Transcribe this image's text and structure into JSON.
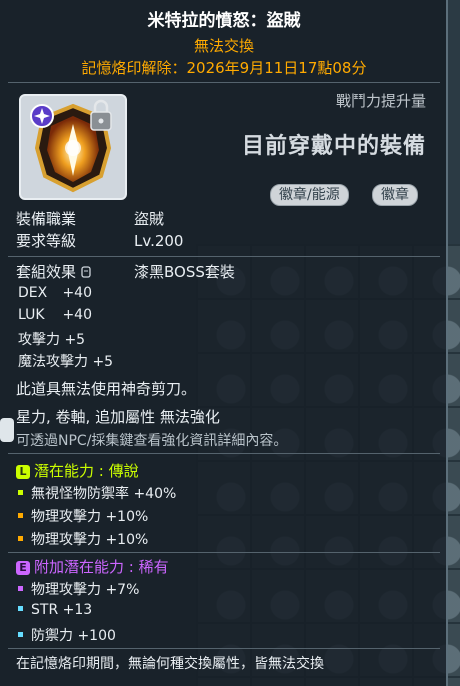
{
  "item": {
    "title": "米特拉的憤怒：盜賊",
    "trade_status": "無法交換",
    "unseal_info": "記憶烙印解除：2026年9月11日17點08分",
    "icon": "mitra-emblem-icon",
    "lock_icon": "lock-icon"
  },
  "header": {
    "power_label": "戰鬥力提升量",
    "wearing_label": "目前穿戴中的裝備",
    "tags": [
      "徽章/能源",
      "徽章"
    ]
  },
  "requirements": {
    "job_label": "裝備職業",
    "job_value": "盜賊",
    "level_label": "要求等級",
    "level_value": "Lv.200"
  },
  "set": {
    "label": "套組效果",
    "value": "漆黑BOSS套裝"
  },
  "stats": [
    {
      "name": "DEX",
      "value": "+40"
    },
    {
      "name": "LUK",
      "value": "+40"
    },
    {
      "name": "攻擊力",
      "value": "+5"
    },
    {
      "name": "魔法攻擊力",
      "value": "+5"
    }
  ],
  "notes": {
    "scissors": "此道具無法使用神奇剪刀。",
    "enhance": "星力, 卷軸, 追加屬性 無法強化",
    "npc_hint": "可透過NPC/採集鍵查看強化資訊詳細內容。"
  },
  "potential": {
    "badge": "L",
    "header": "潛在能力 : 傳說",
    "color": "#ccff00",
    "lines": [
      "無視怪物防禦率 +40%",
      "物理攻擊力 +10%",
      "物理攻擊力 +10%"
    ]
  },
  "additional_potential": {
    "badge": "E",
    "header": "附加潛在能力 : 稀有",
    "color": "#cc66ff",
    "lines": [
      "物理攻擊力 +7%",
      "STR +13",
      "防禦力 +100"
    ]
  },
  "footer": "在記憶烙印期間，無論何種交換屬性，皆無法交換"
}
